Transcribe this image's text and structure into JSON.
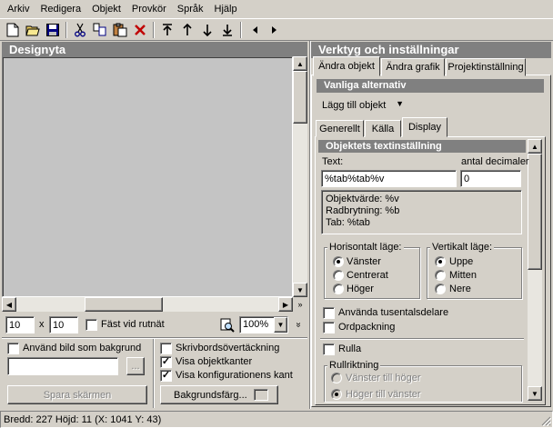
{
  "menu": [
    "Arkiv",
    "Redigera",
    "Objekt",
    "Provkör",
    "Språk",
    "Hjälp"
  ],
  "toolbar": {
    "icons": [
      "new-icon",
      "open-icon",
      "save-icon",
      "cut-icon",
      "copy-icon",
      "paste-icon",
      "delete-icon",
      "move-top-icon",
      "move-up-icon",
      "move-down-icon",
      "move-bottom-icon",
      "arrow-left-icon",
      "arrow-right-icon"
    ]
  },
  "design": {
    "header": "Designyta",
    "width_value": "10",
    "height_value": "10",
    "x_label": "x",
    "snap_label": "Fäst vid rutnät",
    "zoom_value": "100%",
    "use_image_label": "Använd bild som bakgrund",
    "browse_label": "...",
    "save_screen_label": "Spara skärmen",
    "desktop_overlay_label": "Skrivbordsövertäckning",
    "show_borders_label": "Visa objektkanter",
    "show_config_borders_label": "Visa konfigurationens kant",
    "bg_color_label": "Bakgrundsfärg..."
  },
  "tools": {
    "header": "Verktyg och inställningar",
    "tabs": [
      "Ändra objekt",
      "Ändra grafik",
      "Projektinställning"
    ],
    "common_header": "Vanliga alternativ",
    "add_object_label": "Lägg till objekt",
    "sub_tabs": [
      "Generellt",
      "Källa",
      "Display"
    ],
    "text_settings_header": "Objektets textinställning",
    "text_label": "Text:",
    "text_value": "%tab%tab%v",
    "decimals_label": "antal decimaler",
    "decimals_value": "0",
    "info_lines": [
      "Objektvärde: %v",
      "Radbrytning: %b",
      "Tab: %tab"
    ],
    "horizontal_group": "Horisontalt läge:",
    "horizontal_options": [
      "Vänster",
      "Centrerat",
      "Höger"
    ],
    "vertical_group": "Vertikalt läge:",
    "vertical_options": [
      "Uppe",
      "Mitten",
      "Nere"
    ],
    "thousands_label": "Använda tusentalsdelare",
    "wordwrap_label": "Ordpackning",
    "scroll_label": "Rulla",
    "scroll_dir_group": "Rullriktning",
    "scroll_options": [
      "Vänster till höger",
      "Höger till vänster"
    ]
  },
  "status": "Bredd: 227  Höjd: 11  (X: 1041  Y: 43)"
}
